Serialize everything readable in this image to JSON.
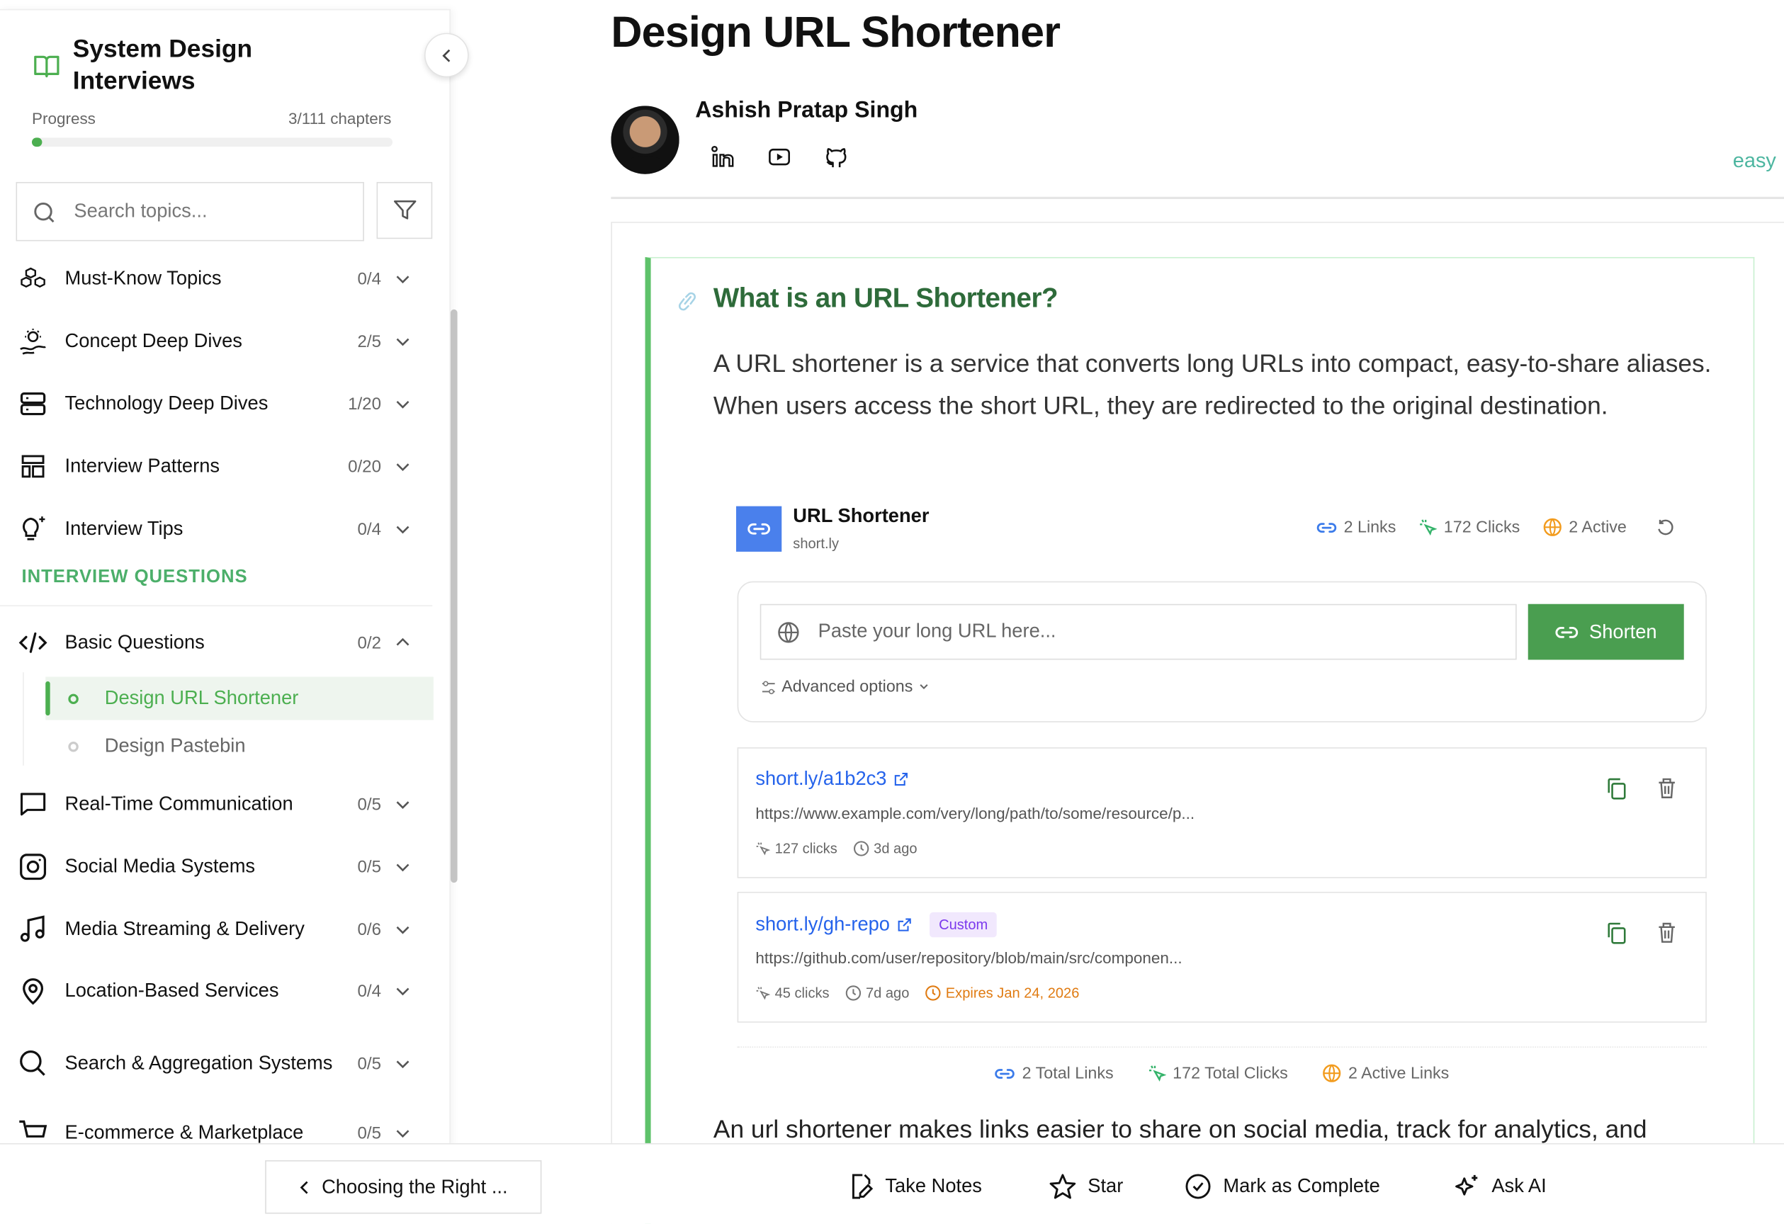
{
  "sidebar": {
    "title": "System Design Interviews",
    "progress_label": "Progress",
    "progress_text": "3/111 chapters",
    "progress_fraction": 0.027,
    "search_placeholder": "Search topics...",
    "section_header": "INTERVIEW QUESTIONS",
    "top_items": [
      {
        "label": "Must-Know Topics",
        "count": "0/4",
        "icon": "cubes-icon"
      },
      {
        "label": "Concept Deep Dives",
        "count": "2/5",
        "icon": "lightbulb-wave-icon"
      },
      {
        "label": "Technology Deep Dives",
        "count": "1/20",
        "icon": "server-icon"
      },
      {
        "label": "Interview Patterns",
        "count": "0/20",
        "icon": "layout-icon"
      },
      {
        "label": "Interview Tips",
        "count": "0/4",
        "icon": "lightbulb-sparkle-icon"
      }
    ],
    "basic": {
      "label": "Basic Questions",
      "count": "0/2",
      "icon": "code-icon",
      "children": [
        {
          "label": "Design URL Shortener",
          "active": true
        },
        {
          "label": "Design Pastebin",
          "active": false
        }
      ]
    },
    "question_items": [
      {
        "label": "Real-Time Communication",
        "count": "0/5",
        "icon": "chat-icon"
      },
      {
        "label": "Social Media Systems",
        "count": "0/5",
        "icon": "instagram-icon"
      },
      {
        "label": "Media Streaming & Delivery",
        "count": "0/6",
        "icon": "music-icon"
      },
      {
        "label": "Location-Based Services",
        "count": "0/4",
        "icon": "map-pin-icon"
      },
      {
        "label": "Search & Aggregation Systems",
        "count": "0/5",
        "icon": "search-icon"
      },
      {
        "label": "E-commerce & Marketplace",
        "count": "0/5",
        "icon": "cart-icon"
      }
    ]
  },
  "article": {
    "title": "Design URL Shortener",
    "author": "Ashish Pratap Singh",
    "social_icons": [
      "linkedin-icon",
      "youtube-icon",
      "github-icon"
    ],
    "difficulty": "easy",
    "section_heading": "What is an URL Shortener?",
    "paragraph": "A URL shortener is a service that converts long URLs into compact, easy-to-share aliases. When users access the short URL, they are redirected to the original destination.",
    "paragraph2": "An url shortener makes links easier to share on social media, track for analytics, and"
  },
  "widget": {
    "title": "URL Shortener",
    "domain": "short.ly",
    "stats": {
      "links": "2 Links",
      "clicks": "172 Clicks",
      "active": "2 Active"
    },
    "input_placeholder": "Paste your long URL here...",
    "shorten_label": "Shorten",
    "advanced_label": "Advanced options",
    "links": [
      {
        "short": "short.ly/a1b2c3",
        "long": "https://www.example.com/very/long/path/to/some/resource/p...",
        "clicks": "127 clicks",
        "age": "3d ago"
      },
      {
        "short": "short.ly/gh-repo",
        "badge": "Custom",
        "long": "https://github.com/user/repository/blob/main/src/componen...",
        "clicks": "45 clicks",
        "age": "7d ago",
        "expires": "Expires Jan 24, 2026"
      }
    ],
    "footer": {
      "links": "2 Total Links",
      "clicks": "172 Total Clicks",
      "active": "2 Active Links"
    },
    "colors": {
      "blue": "#2563eb",
      "green": "#4a9e50",
      "orange": "#f59e0b",
      "purple": "#7c3aed"
    }
  },
  "bottom": {
    "prev_label": "Choosing the Right ...",
    "take_notes": "Take Notes",
    "star": "Star",
    "mark_complete": "Mark as Complete",
    "ask_ai": "Ask AI"
  }
}
